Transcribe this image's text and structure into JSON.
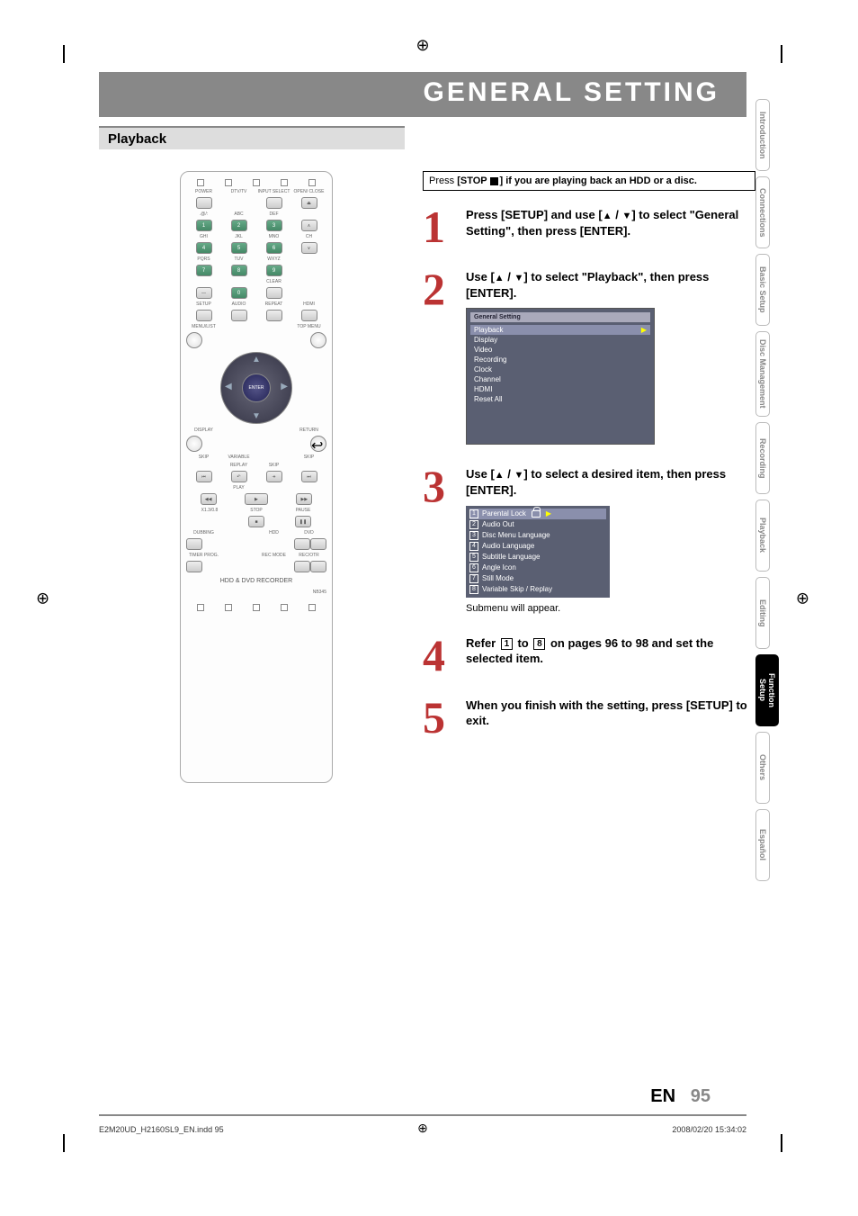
{
  "page_title": "GENERAL SETTING",
  "section": "Playback",
  "notice": {
    "pre": "Press ",
    "bold": "[STOP ",
    "post": "] if you are playing back an HDD or a disc."
  },
  "steps": {
    "s1": {
      "num": "1",
      "text_a": "Press [SETUP] and use [",
      "text_b": " / ",
      "text_c": "] to select \"General Setting\", then press [ENTER]."
    },
    "s2": {
      "num": "2",
      "text_a": "Use [",
      "text_b": " / ",
      "text_c": "] to select \"Playback\", then press [ENTER]."
    },
    "s3": {
      "num": "3",
      "text_a": "Use [",
      "text_b": " / ",
      "text_c": "] to select a desired item, then press [ENTER].",
      "sub": "Submenu will appear."
    },
    "s4": {
      "num": "4",
      "text_a": "Refer ",
      "text_b": " to ",
      "text_c": " on pages 96 to 98 and set the selected item.",
      "box1": "1",
      "box8": "8"
    },
    "s5": {
      "num": "5",
      "text": "When you finish with the setting, press [SETUP] to exit."
    }
  },
  "menu1": {
    "header": "General Setting",
    "items": [
      "Playback",
      "Display",
      "Video",
      "Recording",
      "Clock",
      "Channel",
      "HDMI",
      "Reset All"
    ]
  },
  "menu2": {
    "items": [
      {
        "n": "1",
        "label": "Parental Lock",
        "icon": true
      },
      {
        "n": "2",
        "label": "Audio Out"
      },
      {
        "n": "3",
        "label": "Disc Menu Language"
      },
      {
        "n": "4",
        "label": "Audio Language"
      },
      {
        "n": "5",
        "label": "Subtitle Language"
      },
      {
        "n": "6",
        "label": "Angle Icon"
      },
      {
        "n": "7",
        "label": "Still Mode"
      },
      {
        "n": "8",
        "label": "Variable Skip / Replay"
      }
    ]
  },
  "remote": {
    "labels": {
      "power": "POWER",
      "dtvtv": "DTV/TV",
      "input": "INPUT SELECT",
      "open": "OPEN/ CLOSE",
      "abc": "ABC",
      "def": "DEF",
      "ghi": "GHI",
      "jkl": "JKL",
      "mno": "MNO",
      "ch": "CH",
      "pqrs": "PQRS",
      "tuv": "TUV",
      "wxyz": "WXYZ",
      "clear": "CLEAR",
      "setup": "SETUP",
      "audio": "AUDIO",
      "repeat": "REPEAT",
      "hdmi": "HDMI",
      "menulist": "MENU/LIST",
      "topmenu": "TOP MENU",
      "enter": "ENTER",
      "display": "DISPLAY",
      "return": "RETURN",
      "skip": "SKIP",
      "variable": "VARIABLE",
      "replay": "REPLAY",
      "play": "PLAY",
      "stop": "STOP",
      "pause": "PAUSE",
      "x": "X1.3/0.8",
      "dubbing": "DUBBING",
      "hdd": "HDD",
      "dvd": "DVD",
      "timer": "TIMER PROG.",
      "recmode": "REC MODE",
      "recotr": "REC/OTR",
      "brand": "HDD & DVD RECORDER",
      "model": "NB345",
      "dot": ".@/:"
    },
    "nums": {
      "n1": "1",
      "n2": "2",
      "n3": "3",
      "n4": "4",
      "n5": "5",
      "n6": "6",
      "n7": "7",
      "n8": "8",
      "n9": "9",
      "n0": "0"
    }
  },
  "tabs": [
    "Introduction",
    "Connections",
    "Basic Setup",
    "Disc Management",
    "Recording",
    "Playback",
    "Editing",
    "Function Setup",
    "Others",
    "Español"
  ],
  "footer": {
    "lang": "EN",
    "page": "95",
    "meta_left": "E2M20UD_H2160SL9_EN.indd   95",
    "meta_right": "2008/02/20   15:34:02"
  }
}
